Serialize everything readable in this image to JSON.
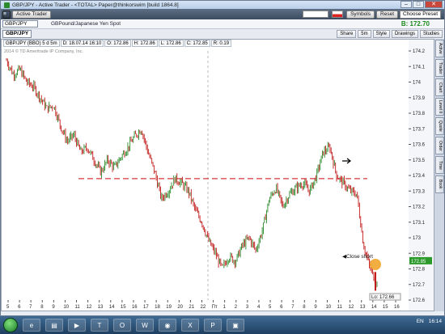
{
  "window": {
    "title": "GBP/JPY - Active Trader - <TOTAL> Paper@thinkorswim [build 1864.8]",
    "controls": [
      "–",
      "□",
      "✕"
    ]
  },
  "toolbar": {
    "active_trader": "Active Trader",
    "symbols": "Symbols",
    "reset": "Reset",
    "choose_preset": "Choose Preset"
  },
  "symbol_bar": {
    "symbol": "GBP/JPY",
    "description": "GBPound/Japanese Yen Spot",
    "bid": "B: 172.70",
    "bid_color": "#1a8a1a"
  },
  "chart_toolbar": {
    "tab": "GBP/JPY",
    "share": "Share",
    "timeframe": "5m",
    "style": "Style",
    "drawings": "Drawings",
    "studies": "Studies"
  },
  "infobar": {
    "symbol": "GBP/JPY (BBO) 5 d 5m",
    "date": "D: 18.07.14 16:10",
    "open": "O: 172.86",
    "high": "H: 172.86",
    "low": "L: 172.86",
    "close": "C: 172.85",
    "range": "R: 0.19"
  },
  "copyright": "2014 © TD Ameritrade IP Company, Inc.",
  "right_tabs": [
    "Active",
    "Trader",
    "Chart",
    "Level II",
    "Quote",
    "Order",
    "Time",
    "Book"
  ],
  "chart_data": {
    "type": "line",
    "y_ticks": [
      "174.2",
      "174.1",
      "174",
      "173.9",
      "173.8",
      "173.7",
      "173.6",
      "173.5",
      "173.4",
      "173.3",
      "173.2",
      "173.1",
      "173",
      "172.9",
      "172.8",
      "172.7",
      "172.6"
    ],
    "ylim": [
      172.6,
      174.2
    ],
    "x_ticks": [
      "5",
      "6",
      "7",
      "8",
      "9",
      "10",
      "11",
      "12",
      "13",
      "14",
      "15",
      "16",
      "17",
      "18",
      "19",
      "20",
      "21",
      "22",
      "Пт",
      "1",
      "2",
      "3",
      "4",
      "5",
      "6",
      "7",
      "8",
      "9",
      "10",
      "11",
      "12",
      "13",
      "14",
      "15",
      "16"
    ],
    "price": [
      174.14,
      174.05,
      174.08,
      174.0,
      173.97,
      173.9,
      173.83,
      173.85,
      173.72,
      173.62,
      173.66,
      173.55,
      173.58,
      173.5,
      173.42,
      173.5,
      173.45,
      173.52,
      173.58,
      173.65,
      173.7,
      173.55,
      173.42,
      173.25,
      173.3,
      173.38,
      173.35,
      173.3,
      173.18,
      173.1,
      172.98,
      172.9,
      172.8,
      172.88,
      172.85,
      172.95,
      173.0,
      172.92,
      173.05,
      173.25,
      173.32,
      173.2,
      173.28,
      173.32,
      173.35,
      173.3,
      173.4,
      173.55,
      173.58,
      173.4,
      173.35,
      173.3,
      173.28,
      172.95,
      172.8,
      172.7
    ],
    "support_line": 173.38,
    "last_price": "172.85",
    "low_label": "Lo: 172.66",
    "annotation": "Close short"
  },
  "colors": {
    "bull": "#2b8a2b",
    "bear": "#c21a1a",
    "support": "#d9363e",
    "marker": "#f0a020"
  },
  "taskbar": {
    "apps": [
      "ie-icon",
      "folder-icon",
      "media-icon",
      "tos-icon",
      "opera-icon",
      "word-icon",
      "chrome-icon",
      "excel-icon",
      "ps-icon",
      "app-icon"
    ],
    "lang": "EN",
    "time": "16:14"
  }
}
